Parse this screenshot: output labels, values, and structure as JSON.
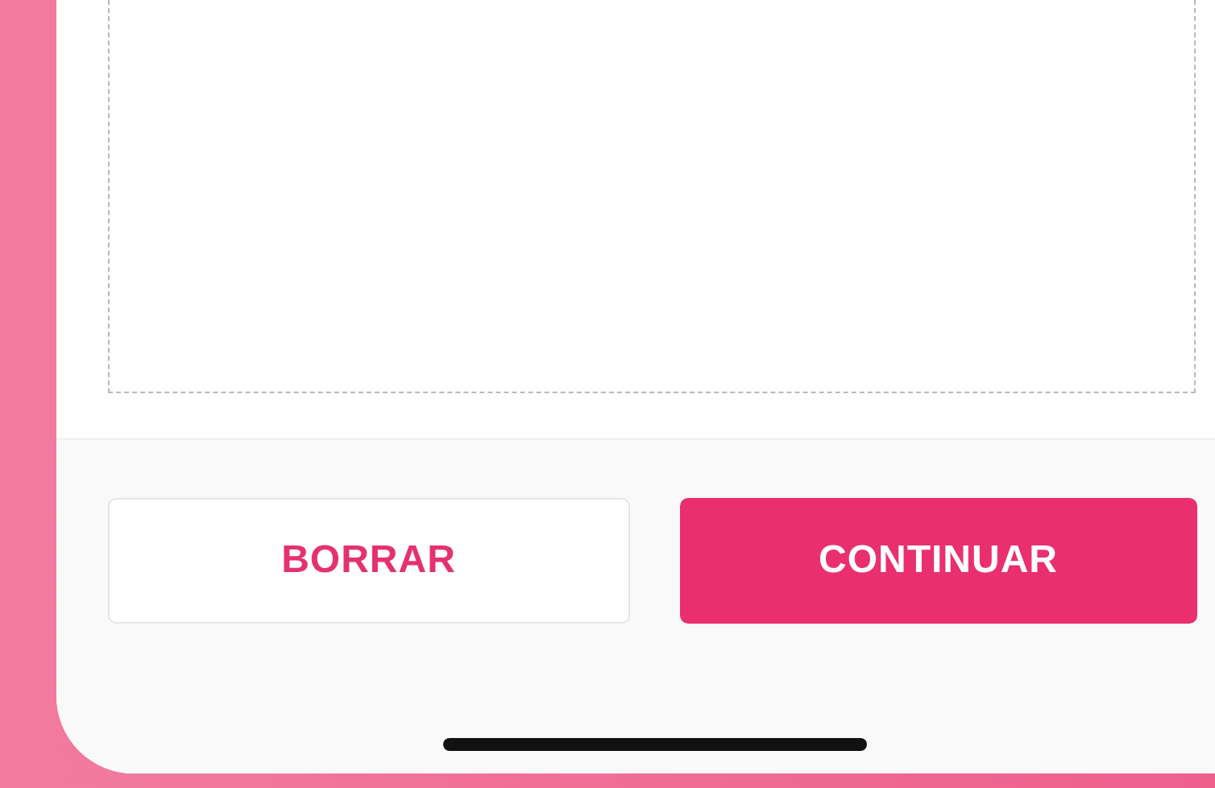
{
  "buttons": [
    {
      "label": "BORRAR",
      "kind": "secondary"
    },
    {
      "label": "CONTINUAR",
      "kind": "primary"
    }
  ]
}
